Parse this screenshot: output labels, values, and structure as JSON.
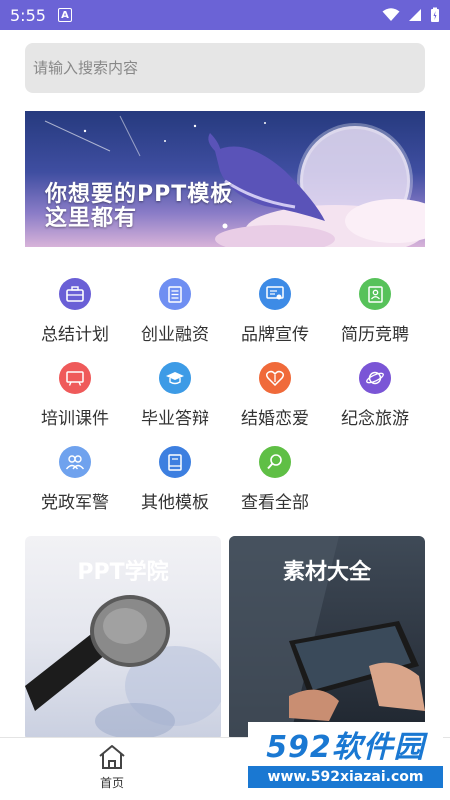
{
  "status": {
    "time": "5:55",
    "notification": "A"
  },
  "search": {
    "placeholder": "请输入搜索内容"
  },
  "banner": {
    "line1": "你想要的PPT模板",
    "line2": "这里都有"
  },
  "categories": [
    {
      "label": "总结计划",
      "icon": "briefcase-icon",
      "color": "#6a5fd6"
    },
    {
      "label": "创业融资",
      "icon": "document-icon",
      "color": "#6f8ff2"
    },
    {
      "label": "品牌宣传",
      "icon": "certificate-icon",
      "color": "#3d8be6"
    },
    {
      "label": "简历竞聘",
      "icon": "resume-icon",
      "color": "#57c25a"
    },
    {
      "label": "培训课件",
      "icon": "presentation-icon",
      "color": "#ef5a5a"
    },
    {
      "label": "毕业答辩",
      "icon": "graduation-cap-icon",
      "color": "#3d9be6"
    },
    {
      "label": "结婚恋爱",
      "icon": "heart-icon",
      "color": "#f06a3a"
    },
    {
      "label": "纪念旅游",
      "icon": "planet-icon",
      "color": "#7a55d6"
    },
    {
      "label": "党政军警",
      "icon": "people-icon",
      "color": "#6fa2ee"
    },
    {
      "label": "其他模板",
      "icon": "book-icon",
      "color": "#3d7fe0"
    },
    {
      "label": "查看全部",
      "icon": "magnifier-icon",
      "color": "#5fbf45"
    }
  ],
  "cards": [
    {
      "title": "PPT学院"
    },
    {
      "title": "素材大全"
    }
  ],
  "tabbar": {
    "home_label": "首页"
  },
  "watermark": {
    "brand": "592软件园",
    "url": "www.592xiazai.com"
  }
}
